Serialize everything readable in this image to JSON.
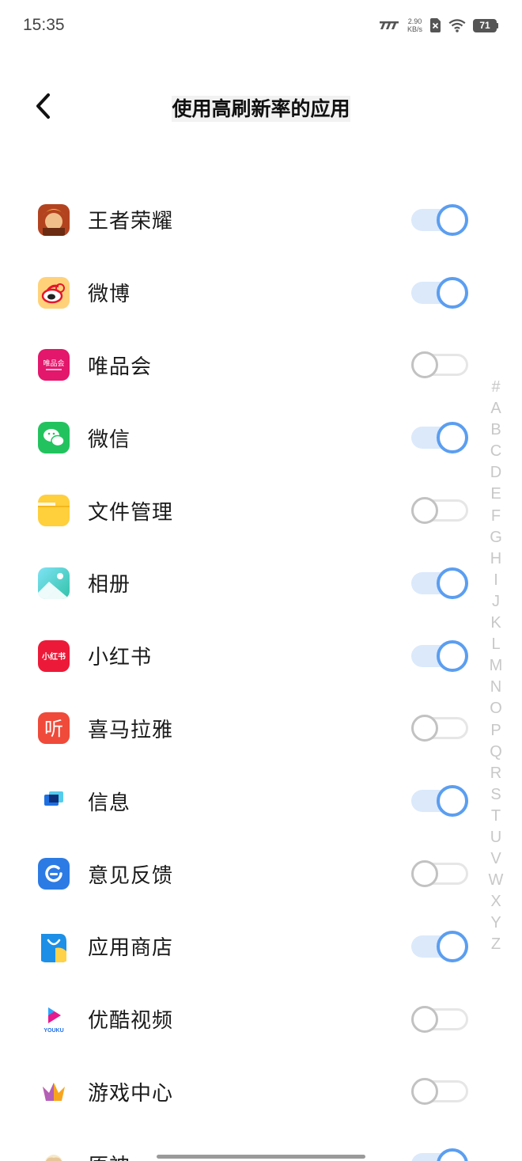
{
  "status_bar": {
    "time": "15:35",
    "net_speed_value": "2.90",
    "net_speed_unit": "KB/s",
    "battery": "71",
    "icons": [
      "signal-icon",
      "no-sim-icon",
      "wifi-icon",
      "battery-icon"
    ]
  },
  "header": {
    "title": "使用高刷新率的应用",
    "back_icon": "chevron-left-icon"
  },
  "apps": [
    {
      "name": "王者荣耀",
      "enabled": true,
      "icon": "honor-of-kings-icon",
      "color": "#b3431f"
    },
    {
      "name": "微博",
      "enabled": true,
      "icon": "weibo-icon",
      "color": "#ffd27a"
    },
    {
      "name": "唯品会",
      "enabled": false,
      "icon": "vipshop-icon",
      "color": "#e3176b",
      "icon_text": "唯品会"
    },
    {
      "name": "微信",
      "enabled": true,
      "icon": "wechat-icon",
      "color": "#22c35e"
    },
    {
      "name": "文件管理",
      "enabled": false,
      "icon": "folder-icon",
      "color": "#ffcf3c"
    },
    {
      "name": "相册",
      "enabled": true,
      "icon": "gallery-icon",
      "color": "#4fd0c8"
    },
    {
      "name": "小红书",
      "enabled": true,
      "icon": "xiaohongshu-icon",
      "color": "#ec1a38",
      "icon_text": "小红书"
    },
    {
      "name": "喜马拉雅",
      "enabled": false,
      "icon": "ximalaya-icon",
      "color": "#f04a3a",
      "icon_text": "听"
    },
    {
      "name": "信息",
      "enabled": true,
      "icon": "messages-icon",
      "color": "#27b3e8"
    },
    {
      "name": "意见反馈",
      "enabled": false,
      "icon": "feedback-icon",
      "color": "#2c7be5"
    },
    {
      "name": "应用商店",
      "enabled": true,
      "icon": "app-store-icon",
      "color": "#1d8fe6"
    },
    {
      "name": "优酷视频",
      "enabled": false,
      "icon": "youku-icon",
      "color": "#e61a8d",
      "icon_text": "YOUKU"
    },
    {
      "name": "游戏中心",
      "enabled": false,
      "icon": "game-center-icon",
      "color": "#a34de0"
    },
    {
      "name": "原神",
      "enabled": true,
      "icon": "genshin-icon",
      "color": "#e7c79a"
    }
  ],
  "alpha_index": [
    "#",
    "A",
    "B",
    "C",
    "D",
    "E",
    "F",
    "G",
    "H",
    "I",
    "J",
    "K",
    "L",
    "M",
    "N",
    "O",
    "P",
    "Q",
    "R",
    "S",
    "T",
    "U",
    "V",
    "W",
    "X",
    "Y",
    "Z"
  ],
  "colors": {
    "toggle_on": "#5b9ef0",
    "toggle_on_track": "#dbe9fb",
    "toggle_off": "#c2c2c2",
    "index_letter": "#c8c8c8"
  }
}
